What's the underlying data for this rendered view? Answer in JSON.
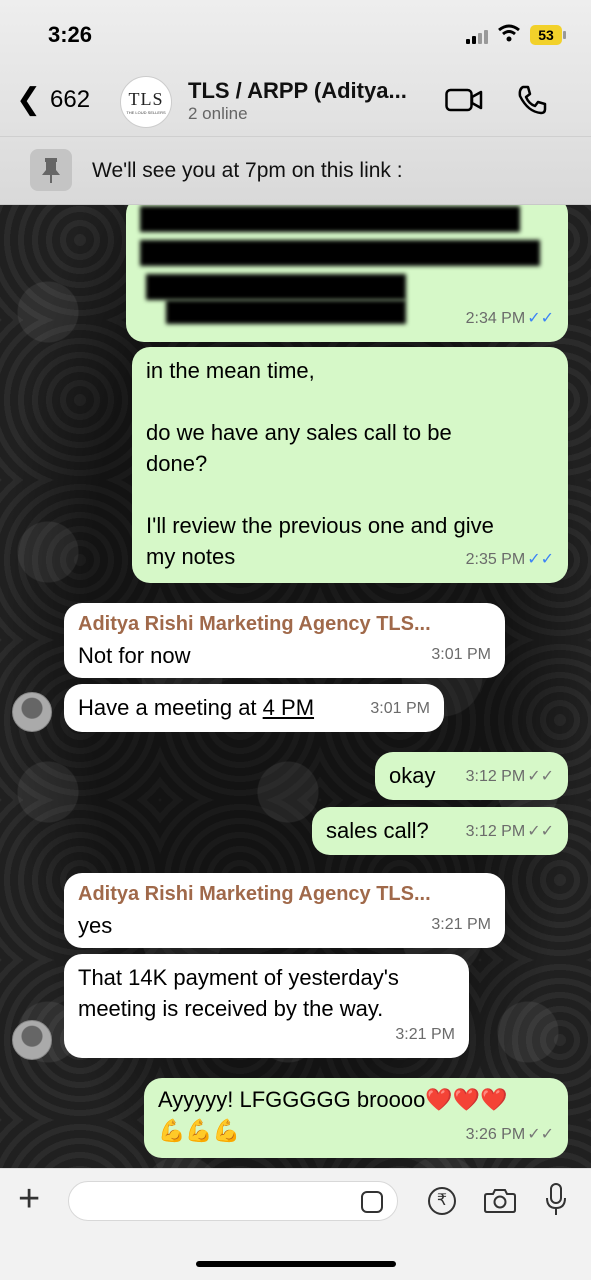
{
  "status_bar": {
    "time": "3:26",
    "battery": "53"
  },
  "header": {
    "back_count": "662",
    "group_title": "TLS / ARPP (Aditya...",
    "group_subtitle": "2 online",
    "avatar_logo": "TLS",
    "avatar_logo_sub": "THE LOUD SELLERS"
  },
  "pinned": {
    "text": "We'll see you at 7pm on this link :"
  },
  "messages": [
    {
      "id": "m0",
      "direction": "out",
      "text": "",
      "time": "2:34 PM",
      "status": "read"
    },
    {
      "id": "m1",
      "direction": "out",
      "lines": [
        "in the mean time,",
        "",
        "do we have any sales call to be",
        "done?",
        "",
        "I'll review the previous one and give",
        "my notes"
      ],
      "time": "2:35 PM",
      "status": "read"
    },
    {
      "id": "m2",
      "direction": "in",
      "sender": "Aditya Rishi Marketing Agency TLS...",
      "text": "Not for now",
      "time": "3:01 PM"
    },
    {
      "id": "m3",
      "direction": "in",
      "text_before": "Have a meeting at ",
      "link": "4 PM",
      "time": "3:01 PM"
    },
    {
      "id": "m4",
      "direction": "out",
      "text": "okay",
      "time": "3:12 PM",
      "status": "delivered"
    },
    {
      "id": "m5",
      "direction": "out",
      "text": "sales call?",
      "time": "3:12 PM",
      "status": "delivered"
    },
    {
      "id": "m6",
      "direction": "in",
      "sender": "Aditya Rishi Marketing Agency TLS...",
      "text": "yes",
      "time": "3:21 PM"
    },
    {
      "id": "m7",
      "direction": "in",
      "lines": [
        "That 14K payment of yesterday's",
        "meeting is received by the way."
      ],
      "time": "3:21 PM"
    },
    {
      "id": "m8",
      "direction": "out",
      "text": "Ayyyyy! LFGGGGG broooo❤️❤️❤️",
      "emoji_line": "💪💪💪",
      "time": "3:26 PM",
      "status": "delivered"
    }
  ],
  "input_bar": {
    "placeholder": ""
  },
  "colors": {
    "outgoing": "#d6f8c8",
    "incoming": "#ffffff",
    "sender_name": "#a0694a",
    "read_tick": "#3b82f6"
  }
}
